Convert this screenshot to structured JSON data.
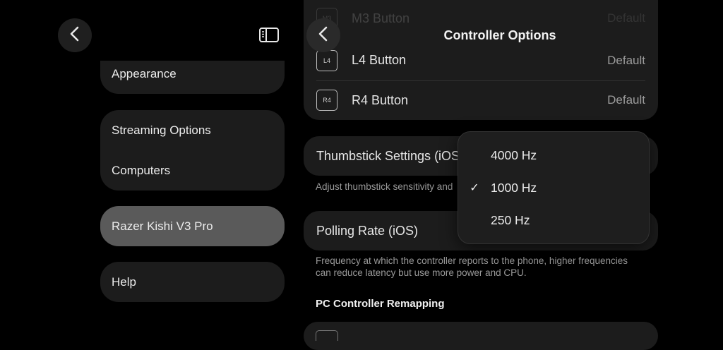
{
  "left": {
    "back_icon": "chevron-left-icon",
    "sidebar_icon": "sidebar-toggle-icon",
    "cards": [
      {
        "items": [
          "Appearance"
        ]
      },
      {
        "items": [
          "Streaming Options",
          "Computers"
        ]
      },
      {
        "items": [
          "Razer Kishi V3 Pro"
        ],
        "selected": true
      },
      {
        "items": [
          "Help"
        ]
      }
    ]
  },
  "header": {
    "title": "Controller Options",
    "back_icon": "chevron-left-icon"
  },
  "buttons_list": [
    {
      "badge": "M3",
      "label": "M3 Button",
      "value": "Default"
    },
    {
      "badge": "L4",
      "label": "L4 Button",
      "value": "Default"
    },
    {
      "badge": "R4",
      "label": "R4 Button",
      "value": "Default"
    }
  ],
  "thumbstick": {
    "label": "Thumbstick Settings (iOS)",
    "caption": "Adjust thumbstick sensitivity and"
  },
  "polling": {
    "label": "Polling Rate (iOS)",
    "caption_line1": "Frequency at which the controller reports to the phone, higher frequencies",
    "caption_line2": "can reduce latency but use more power and CPU."
  },
  "remap_section": {
    "title": "PC Controller Remapping"
  },
  "popup": {
    "options": [
      "4000 Hz",
      "1000 Hz",
      "250 Hz"
    ],
    "selected": "1000 Hz",
    "check_mark": "✓"
  },
  "colors": {
    "background": "#000000",
    "card": "#1c1c1c",
    "selected_card": "#5a5a5a",
    "secondary_text": "#9c9c9c"
  }
}
